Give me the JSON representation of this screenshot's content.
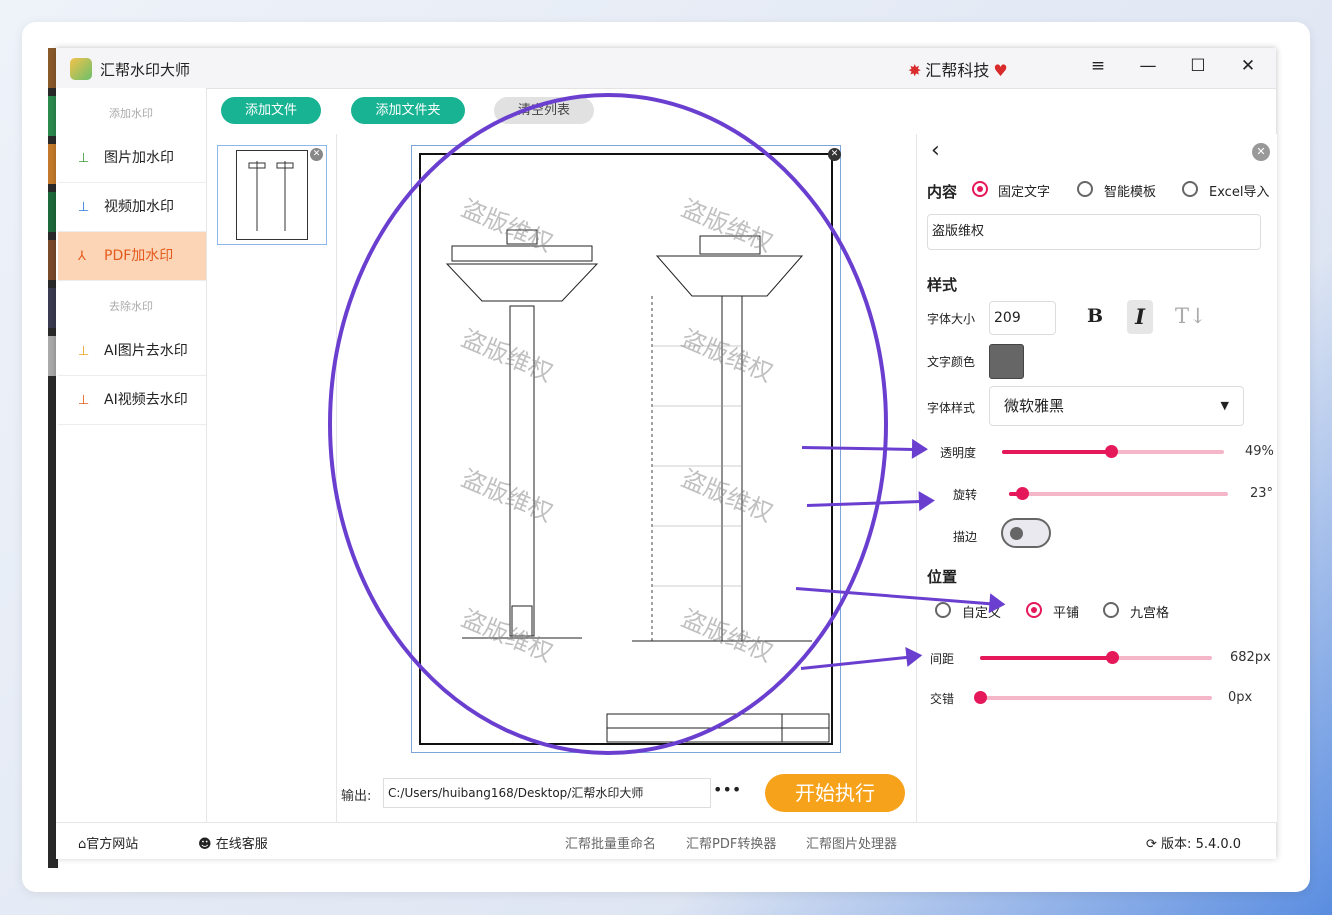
{
  "app": {
    "title": "汇帮水印大师",
    "brand": "汇帮科技"
  },
  "window_controls": {
    "menu": "≡",
    "minimize": "—",
    "maximize": "☐",
    "close": "✕"
  },
  "sidebar": {
    "section_add": "添加水印",
    "items": [
      {
        "label": "图片加水印",
        "icon": "image-stamp-icon"
      },
      {
        "label": "视频加水印",
        "icon": "video-stamp-icon"
      },
      {
        "label": "PDF加水印",
        "icon": "pdf-icon",
        "active": true
      }
    ],
    "section_remove": "去除水印",
    "remove_items": [
      {
        "label": "AI图片去水印",
        "icon": "ai-image-icon"
      },
      {
        "label": "AI视频去水印",
        "icon": "ai-video-icon"
      }
    ]
  },
  "toolbar": {
    "add_file": "添加文件",
    "add_folder": "添加文件夹",
    "clear_list": "清空列表"
  },
  "preview": {
    "watermark_text": "盗版维权"
  },
  "output": {
    "label": "输出:",
    "path": "C:/Users/huibang168/Desktop/汇帮水印大师",
    "more": "•••"
  },
  "start_button": "开始执行",
  "settings": {
    "content_label": "内容",
    "content_options": [
      "固定文字",
      "智能模板",
      "Excel导入"
    ],
    "content_selected": 0,
    "text_value": "盗版维权",
    "style_label": "样式",
    "font_size_label": "字体大小",
    "font_size": "209",
    "bold_btn": "B",
    "italic_btn": "I",
    "strike_btn": "T",
    "color_label": "文字颜色",
    "color_value": "#666666",
    "font_style_label": "字体样式",
    "font_family_value": "微软雅黑",
    "opacity_label": "透明度",
    "opacity_value": "49%",
    "opacity": 0.49,
    "rotate_label": "旋转",
    "rotate_value": "23°",
    "rotate": 0.06,
    "stroke_label": "描边",
    "position_label": "位置",
    "position_options": [
      "自定义",
      "平铺",
      "九宫格"
    ],
    "position_selected": 1,
    "spacing_label": "间距",
    "spacing_value": "682px",
    "spacing": 0.57,
    "stagger_label": "交错",
    "stagger_value": "0px",
    "stagger": 0
  },
  "footer": {
    "website": "官方网站",
    "support": "在线客服",
    "tool1": "汇帮批量重命名",
    "tool2": "汇帮PDF转换器",
    "tool3": "汇帮图片处理器",
    "version_label": "版本:",
    "version": "5.4.0.0"
  },
  "colors": {
    "accent": "#e5185a",
    "green": "#18b392",
    "orange": "#f7a21b",
    "annotation": "#6a3fd0"
  }
}
